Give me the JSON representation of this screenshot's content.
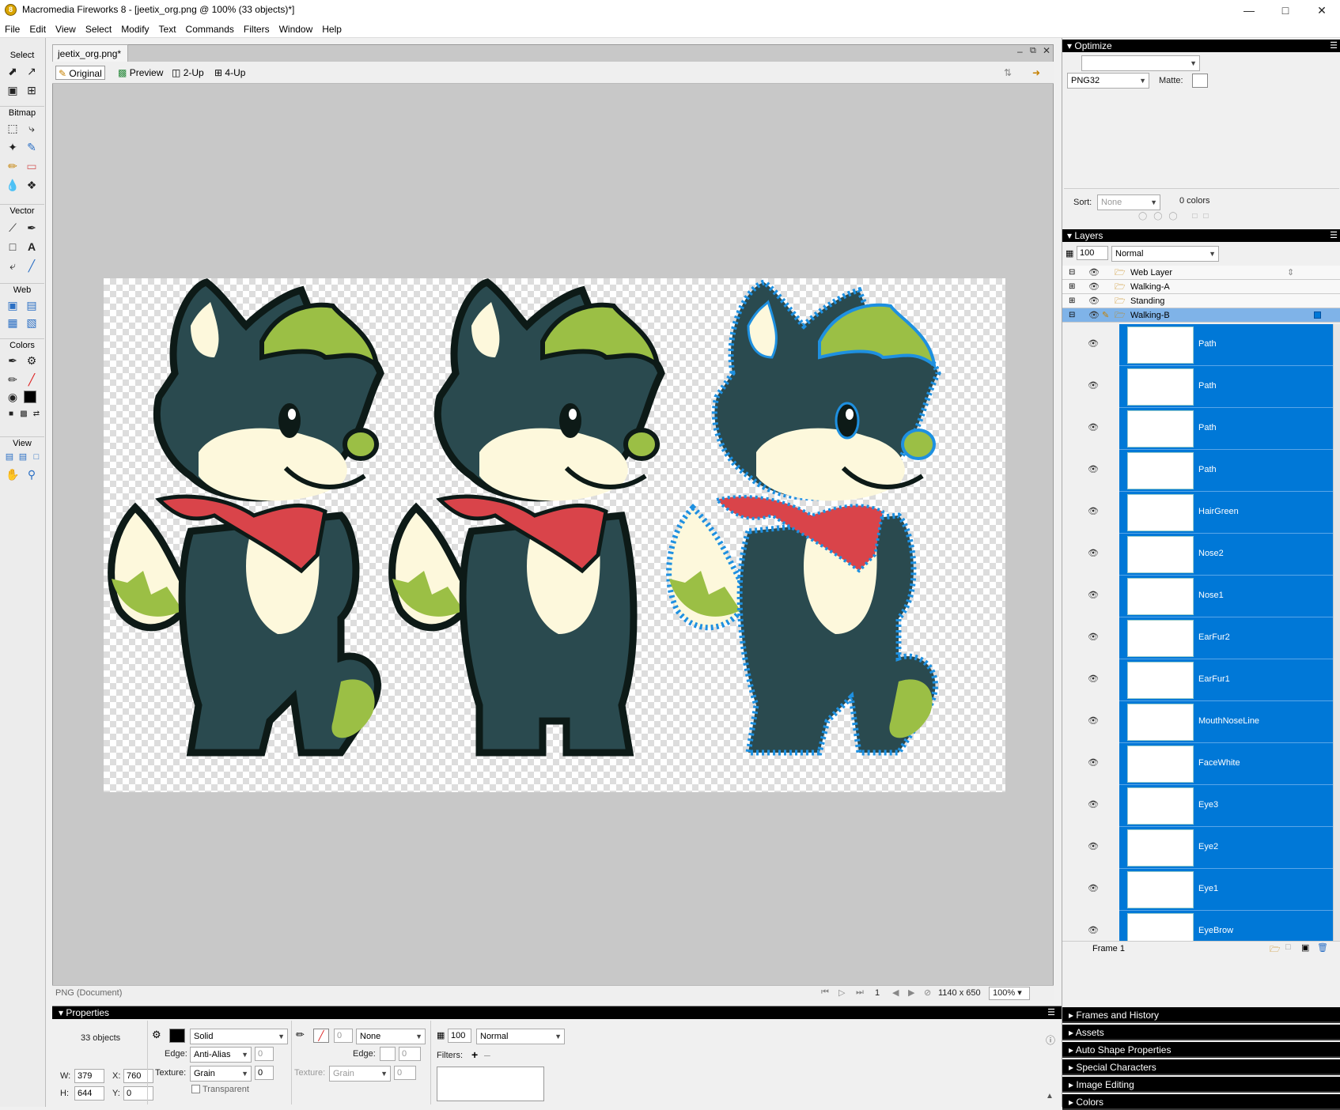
{
  "window": {
    "title": "Macromedia Fireworks 8 - [jeetix_org.png @ 100% (33 objects)*]",
    "app_icon": "fireworks-icon"
  },
  "menu": [
    "File",
    "Edit",
    "View",
    "Select",
    "Modify",
    "Text",
    "Commands",
    "Filters",
    "Window",
    "Help"
  ],
  "toolbox": {
    "sections": [
      "Select",
      "Bitmap",
      "Vector",
      "Web",
      "Colors",
      "View"
    ]
  },
  "document": {
    "tab_label": "jeetix_org.png*",
    "views": [
      "Original",
      "Preview",
      "2-Up",
      "4-Up"
    ],
    "status_left": "PNG (Document)",
    "frame": "1",
    "size": "1140 x 650",
    "zoom": "100%"
  },
  "optimize": {
    "header": "Optimize",
    "format": "PNG32",
    "matte_label": "Matte:",
    "sort_label": "Sort:",
    "sort_value": "None",
    "colors_count": "0 colors"
  },
  "layers": {
    "header": "Layers",
    "opacity": "100",
    "blend": "Normal",
    "folders": [
      "Web Layer",
      "Walking-A",
      "Standing",
      "Walking-B"
    ],
    "objects": [
      "Path",
      "Path",
      "Path",
      "Path",
      "HairGreen",
      "Nose2",
      "Nose1",
      "EarFur2",
      "EarFur1",
      "MouthNoseLine",
      "FaceWhite",
      "Eye3",
      "Eye2",
      "Eye1",
      "EyeBrow"
    ],
    "frame_label": "Frame 1"
  },
  "collapsed_panels": [
    "Frames and History",
    "Assets",
    "Auto Shape Properties",
    "Special Characters",
    "Image Editing",
    "Colors"
  ],
  "properties": {
    "header": "Properties",
    "summary": "33 objects",
    "w_label": "W:",
    "w": "379",
    "h_label": "H:",
    "h": "644",
    "x_label": "X:",
    "x": "760",
    "y_label": "Y:",
    "y": "0",
    "fill_type": "Solid",
    "edge_label": "Edge:",
    "edge_value": "Anti-Alias",
    "edge_amount": "0",
    "texture_label": "Texture:",
    "texture_value": "Grain",
    "texture_amount": "0",
    "transparent_label": "Transparent",
    "stroke_size": "0",
    "stroke_type": "None",
    "stroke_edge_label": "Edge:",
    "stroke_edge_amount": "0",
    "stroke_texture_label": "Texture:",
    "stroke_texture_value": "Grain",
    "stroke_texture_amount": "0",
    "opacity": "100",
    "blend": "Normal",
    "filters_label": "Filters:"
  },
  "colors": {
    "selection": "#0078d7",
    "fox_dark": "#2a4a4f",
    "fox_cream": "#fdf8dc",
    "hair_green": "#9bbf45",
    "bandana": "#d9444a",
    "outline": "#0d1a17",
    "path_blue": "#1e90e0"
  }
}
